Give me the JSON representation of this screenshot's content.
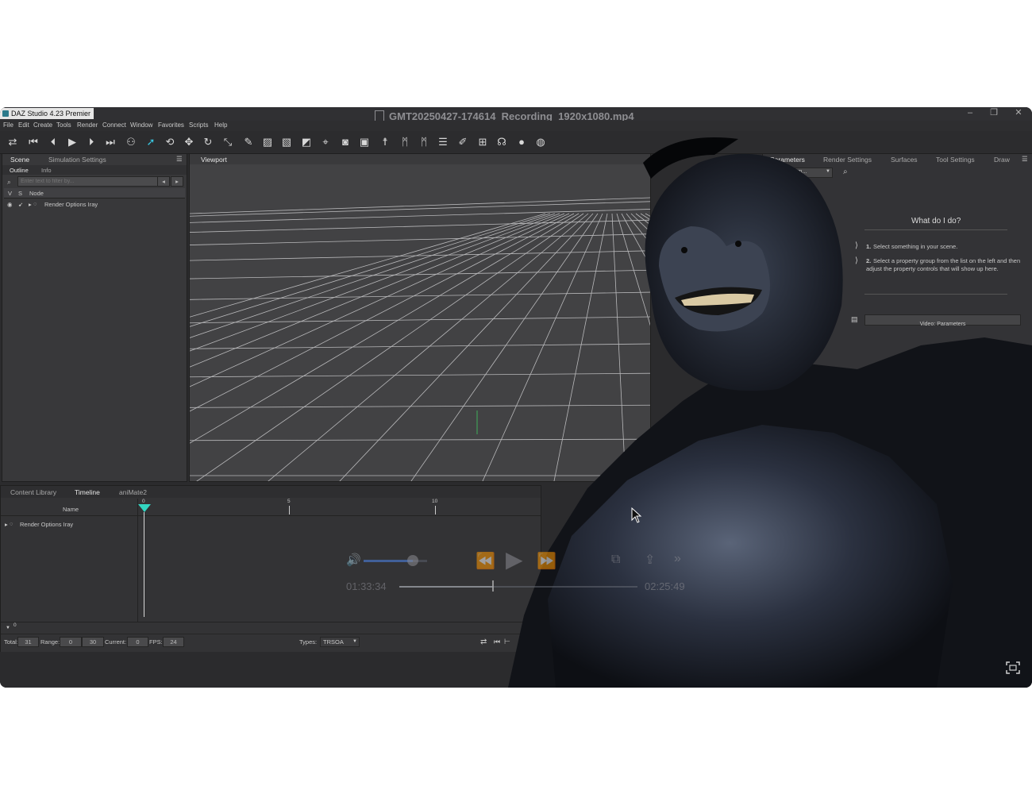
{
  "window": {
    "app_title": "DAZ Studio 4.23 Premier",
    "video_title": "GMT20250427-174614_Recording_1920x1080.mp4",
    "controls": {
      "minimize": "–",
      "restore": "❐",
      "close": "✕"
    }
  },
  "menubar": [
    "File",
    "Edit",
    "Create",
    "Tools",
    "Render",
    "Connect",
    "Window",
    "Favorites",
    "Scripts",
    "Help"
  ],
  "toolbar": {
    "icons": [
      "cycle-icon",
      "skip-start-icon",
      "step-back-icon",
      "play-icon",
      "step-forward-icon",
      "skip-end-icon",
      "node-select-icon",
      "pointer-icon",
      "rotate-view-icon",
      "translate-icon",
      "rotate-icon",
      "scale-icon",
      "joint-editor-icon",
      "geometry-editor-icon",
      "surface-selection-icon",
      "node-weight-icon",
      "magnet-icon",
      "camera-icon",
      "render-icon",
      "figure-pose-icon",
      "active-pose-icon",
      "powerpose-icon",
      "list-icon",
      "paint-icon",
      "region-icon",
      "light-icon",
      "sphere-icon",
      "shader-icon"
    ],
    "accent": "#39c6e0"
  },
  "scene_panel": {
    "tabs": [
      "Scene",
      "Simulation Settings"
    ],
    "subtabs": [
      "Outline",
      "Info"
    ],
    "search_placeholder": "Enter text to filter by...",
    "columns": [
      "V",
      "S",
      "Node"
    ],
    "nodes": [
      "Render Options Iray"
    ]
  },
  "viewport": {
    "tab": "Viewport"
  },
  "right_panel": {
    "tabs": [
      "Parameters",
      "Render Settings",
      "Surfaces",
      "Tool Settings",
      "Draw"
    ],
    "dropdown": "n Item...",
    "help_title": "What do I do?",
    "steps": [
      {
        "num": "1.",
        "text": "Select something in your scene."
      },
      {
        "num": "2.",
        "text": "Select a property group from the list on the left and then adjust the property controls that will show up here."
      }
    ],
    "video_link": "Video: Parameters"
  },
  "timeline_panel": {
    "tabs": [
      "Content Library",
      "Timeline",
      "aniMate2"
    ],
    "name_header": "Name",
    "ruler_labels": [
      "0",
      "5",
      "10"
    ],
    "rows": [
      "Render Options Iray"
    ],
    "scroll_value": "0",
    "footer": {
      "total_label": "Total:",
      "total": "31",
      "range_label": "Range:",
      "range_start": "0",
      "range_end": "30",
      "current_label": "Current:",
      "current": "0",
      "fps_label": "FPS:",
      "fps": "24",
      "types_label": "Types:",
      "types": "TRSOA"
    }
  },
  "video_player": {
    "elapsed": "01:33:34",
    "remaining": "02:25:49",
    "volume": 0.78,
    "progress": 0.39
  }
}
